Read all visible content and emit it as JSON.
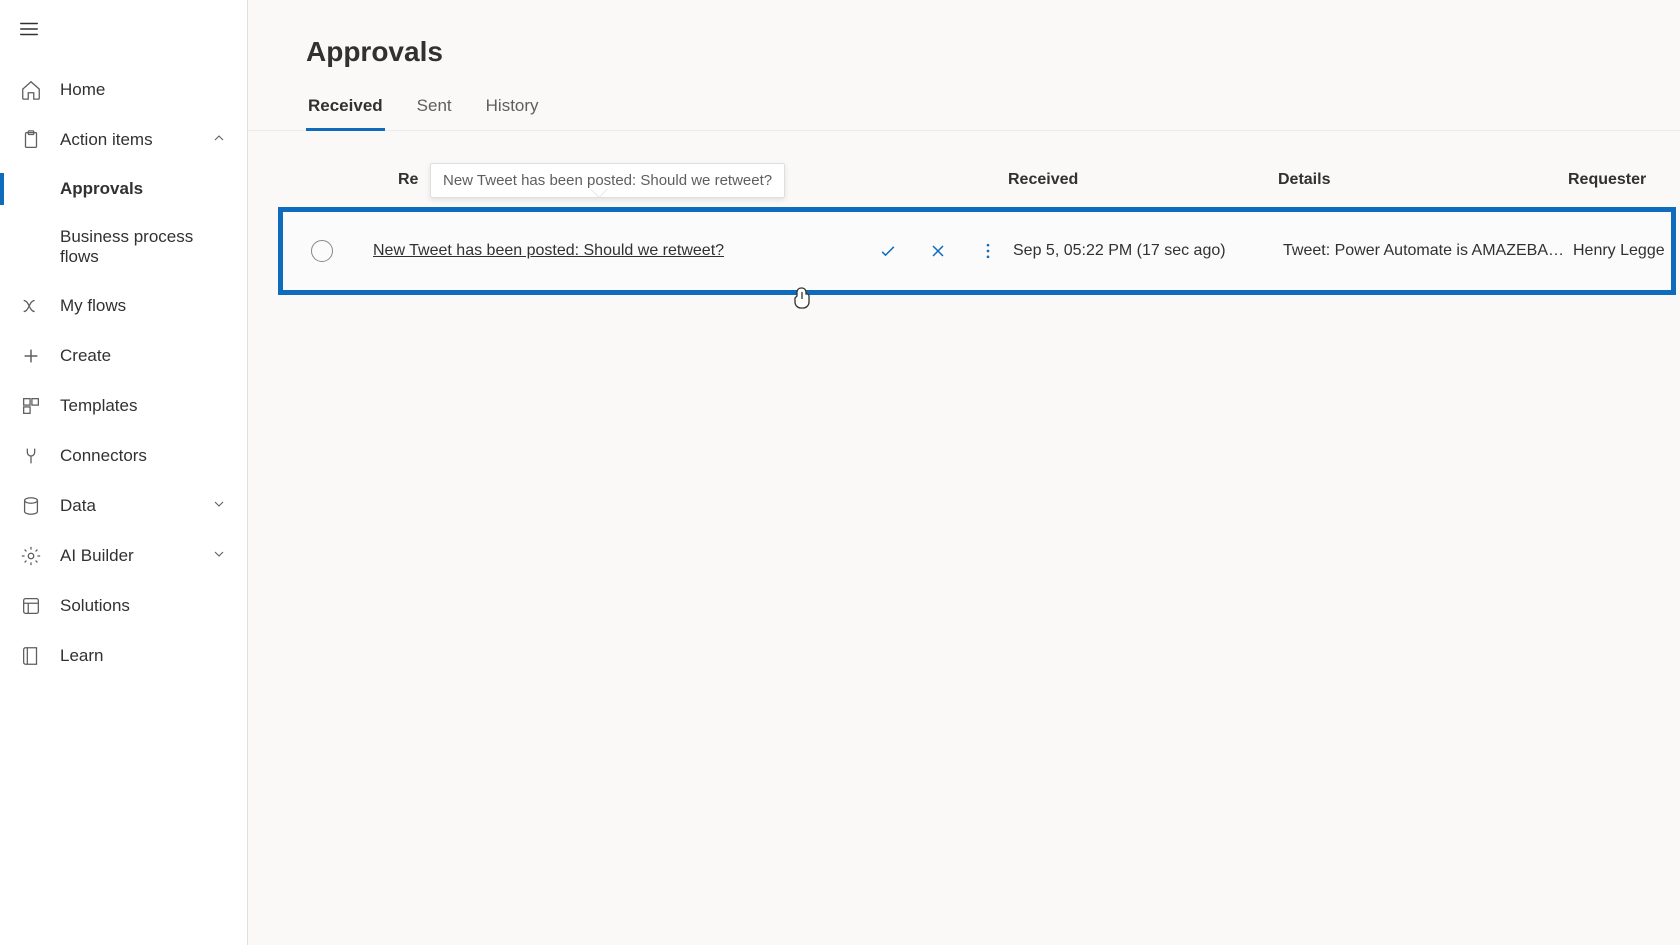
{
  "sidebar": {
    "items": [
      {
        "label": "Home"
      },
      {
        "label": "Action items"
      },
      {
        "label": "Approvals"
      },
      {
        "label": "Business process flows"
      },
      {
        "label": "My flows"
      },
      {
        "label": "Create"
      },
      {
        "label": "Templates"
      },
      {
        "label": "Connectors"
      },
      {
        "label": "Data"
      },
      {
        "label": "AI Builder"
      },
      {
        "label": "Solutions"
      },
      {
        "label": "Learn"
      }
    ]
  },
  "page": {
    "title": "Approvals",
    "tabs": [
      {
        "label": "Received"
      },
      {
        "label": "Sent"
      },
      {
        "label": "History"
      }
    ]
  },
  "table": {
    "headers": {
      "request": "Request",
      "request_visible_prefix": "Re",
      "received": "Received",
      "details": "Details",
      "requester": "Requester"
    },
    "tooltip": "New Tweet has been posted: Should we retweet?",
    "rows": [
      {
        "title": "New Tweet has been posted: Should we retweet?",
        "received": "Sep 5, 05:22 PM (17 sec ago)",
        "details": "Tweet: Power Automate is AMAZEBA…",
        "requester": "Henry Legge"
      }
    ]
  },
  "colors": {
    "accent": "#0f6cbd"
  }
}
